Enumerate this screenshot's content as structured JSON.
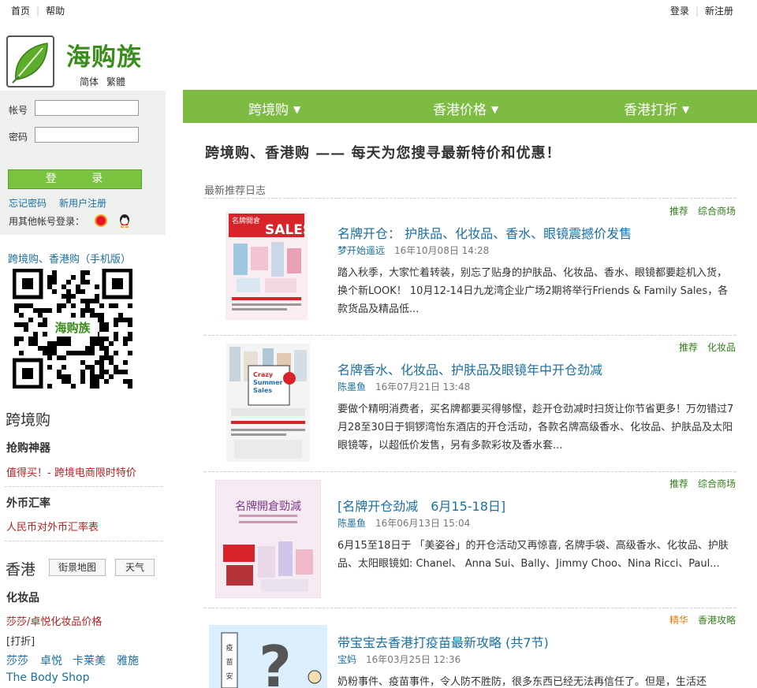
{
  "topbar": {
    "home": "首页",
    "help": "帮助",
    "login": "登录",
    "register": "新注册"
  },
  "brand": {
    "name": "海购族",
    "simplified": "简体",
    "traditional": "繁體",
    "color": "#3a8c1c"
  },
  "login_panel": {
    "account_label": "帐号",
    "password_label": "密码",
    "button": "登 录",
    "forgot": "忘记密码",
    "new_user": "新用户注册",
    "other_login": "用其他帐号登录："
  },
  "mobile": {
    "link": "跨境购、香港购（手机版）",
    "qr_caption": "海购族"
  },
  "sidebar": {
    "crossborder_title": "跨境购",
    "tool_title": "抢购神器",
    "tool_link": "值得买！- 跨境电商限时特价",
    "fx_title": "外币汇率",
    "fx_link": "人民币对外币汇率表",
    "hk_title": "香港",
    "hk_map_btn": "街景地图",
    "hk_weather_btn": "天气",
    "cosmetics_title": "化妆品",
    "cosmetics_link": "莎莎/卓悦化妆品价格",
    "discount_label": "[打折]",
    "shops": [
      "莎莎",
      "卓悦",
      "卡莱美",
      "雅施"
    ],
    "bodyshop": "The Body Shop"
  },
  "nav": {
    "items": [
      "跨境购",
      "香港价格",
      "香港打折"
    ],
    "color": "#7dbb42"
  },
  "main": {
    "headline": "跨境购、香港购 —— 每天为您搜寻最新特价和优惠！",
    "recent_label": "最新推荐日志"
  },
  "posts": [
    {
      "tags": [
        "推荐",
        "综合商场"
      ],
      "title": "名牌开仓： 护肤品、化妆品、香水、眼镜震撼价发售",
      "author": "梦开始遥远",
      "date": "16年10月08日 14:28",
      "body": "踏入秋季，大家忙着转装，别忘了贴身的护肤品、化妆品、香水、眼镜都要趁机入货，换个新LOOK！ 10月12-14日九龙湾企业广场2期将举行Friends & Family Sales，各款货品及精品低..."
    },
    {
      "tags": [
        "推荐",
        "化妆品"
      ],
      "title": "名牌香水、化妆品、护肤品及眼镜年中开仓劲减",
      "author": "陈墨鱼",
      "date": "16年07月21日 13:48",
      "body": "要做个精明消费者，买名牌都要买得够慳，趁开仓劲减时扫货让你节省更多！万勿错过7月28至30日于铜锣湾怡东酒店的开仓活动，各款名牌高级香水、化妆品、护肤品及太阳眼镜等，以超低价发售，另有多款彩妆及香水套..."
    },
    {
      "tags": [
        "推荐",
        "综合商场"
      ],
      "title": "[名牌开仓劲减　6月15-18日]",
      "author": "陈墨鱼",
      "date": "16年06月13日 15:04",
      "body": "6月15至18日于 「美姿谷」的开仓活动又再惊喜, 名牌手袋、高级香水、化妆品、护肤品、太阳眼镜如: Chanel、 Anna Sui、Bally、Jimmy Choo、Nina Ricci、Paul..."
    },
    {
      "tags": [
        "精华",
        "香港攻略"
      ],
      "title": "带宝宝去香港打疫苗最新攻略 (共7节)",
      "author": "宝妈",
      "date": "16年03月25日 12:36",
      "body": "奶粉事件、疫苗事件，令人防不胜防，很多东西已经无法再信任了。但是，生活还"
    }
  ],
  "thumb_text": {
    "sales": "SALES",
    "pai": "名牌開倉",
    "crazy": "Crazy Summer Sales",
    "jin": "名牌開倉勁減",
    "vaccine": "疫苗"
  }
}
